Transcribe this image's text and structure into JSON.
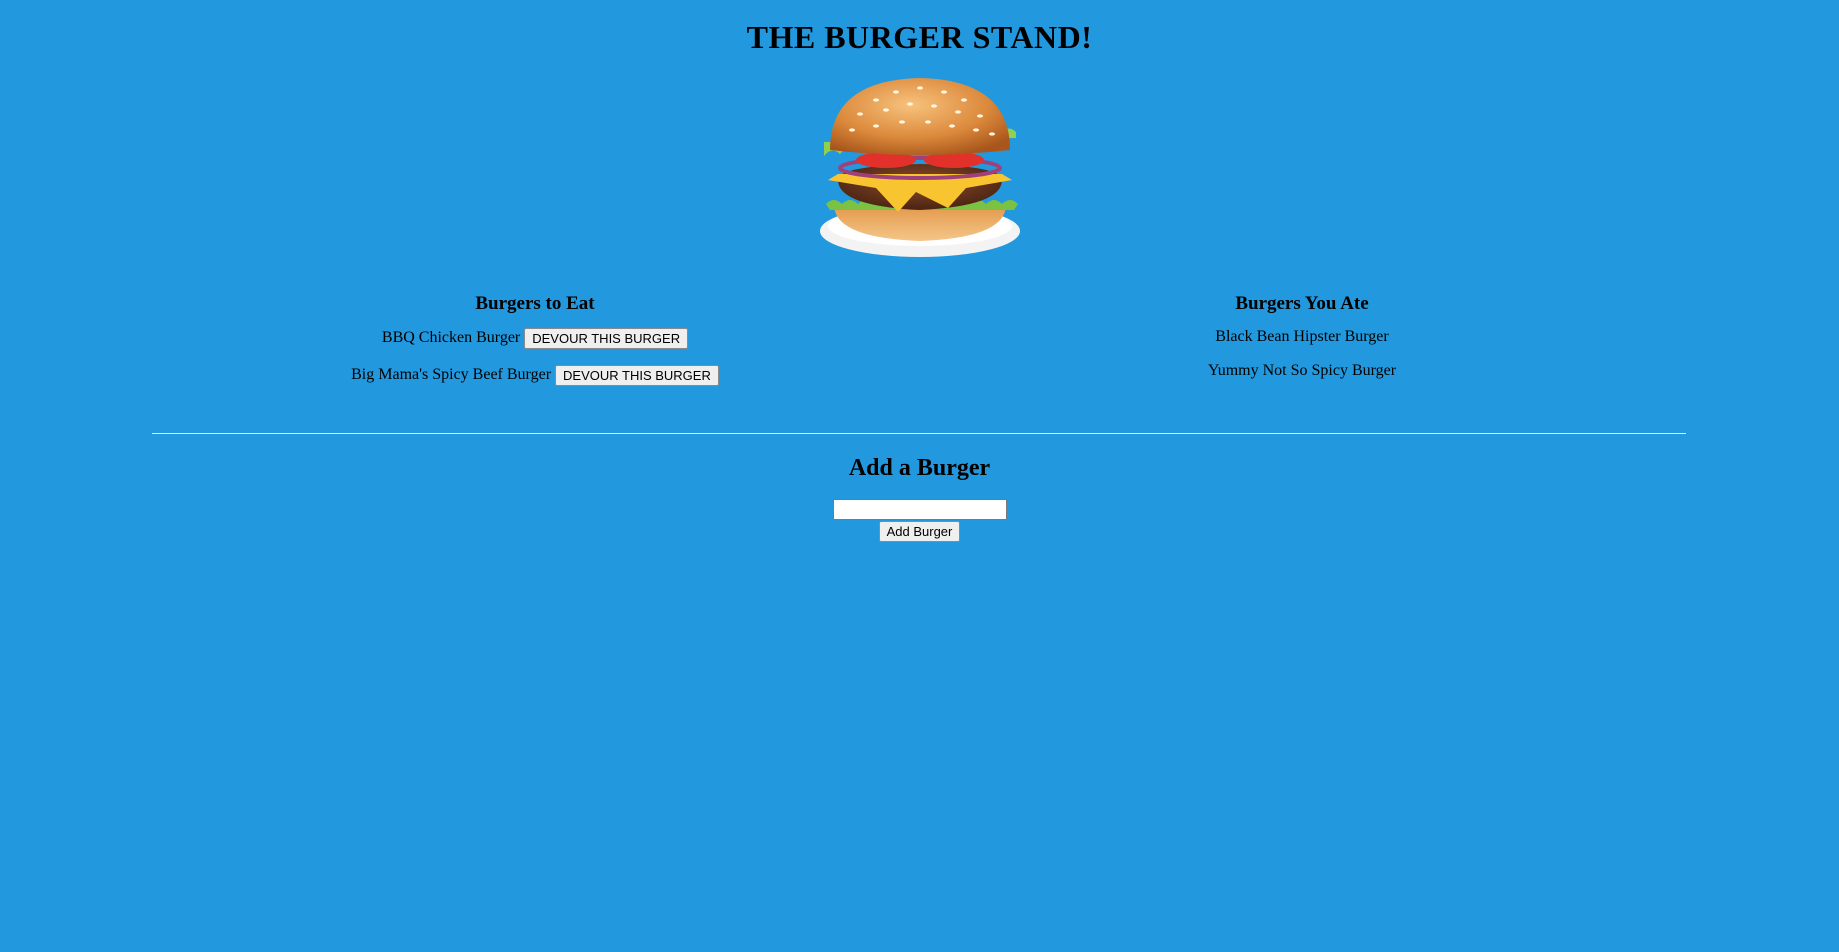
{
  "header": {
    "title": "THE BURGER STAND!"
  },
  "hero": {
    "image": "burger-icon"
  },
  "to_eat": {
    "heading": "Burgers to Eat",
    "items": [
      {
        "name": "BBQ Chicken Burger",
        "button": "DEVOUR THIS BURGER"
      },
      {
        "name": "Big Mama's Spicy Beef Burger",
        "button": "DEVOUR THIS BURGER"
      }
    ]
  },
  "eaten": {
    "heading": "Burgers You Ate",
    "items": [
      "Black Bean Hipster Burger",
      "Yummy Not So Spicy Burger"
    ]
  },
  "add": {
    "heading": "Add a Burger",
    "input_value": "",
    "button": "Add Burger"
  },
  "colors": {
    "background": "#2298de",
    "divider": "#e6f2fb"
  }
}
